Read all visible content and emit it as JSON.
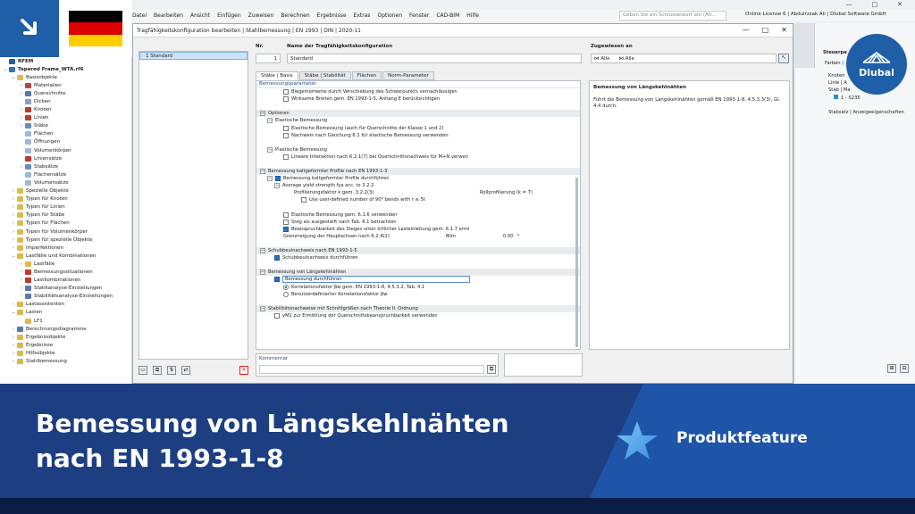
{
  "menu": [
    "Datei",
    "Bearbeiten",
    "Ansicht",
    "Einfügen",
    "Zuweisen",
    "Berechnen",
    "Ergebnisse",
    "Extras",
    "Optionen",
    "Fenster",
    "CAD-BIM",
    "Hilfe"
  ],
  "search_placeholder": "Geben Sie ein Schlüsselwort ein (Alt…",
  "license": "Online License 6 | Abdulrzzak Ali | Dlubal Software GmbH",
  "window": {
    "title": "Tragfähigkeitskonfiguration bearbeiten | Stahlbemessung | EN 1993 | DIN | 2020-11",
    "minimize": "—",
    "maximize": "□",
    "close": "✕"
  },
  "nav": {
    "items": [
      {
        "label": "RFEM",
        "arrow": "",
        "color": "#2c5aa0",
        "indent": 0
      },
      {
        "label": "Tapered Frame_WTA.rf6",
        "arrow": "⌄",
        "color": "#3b6fb5",
        "indent": 0
      },
      {
        "label": "Basisobjekte",
        "arrow": "⌄",
        "color": "#e0b84a",
        "indent": 1
      },
      {
        "label": "Materialien",
        "arrow": "›",
        "color": "#b04a3a",
        "indent": 2
      },
      {
        "label": "Querschnitte",
        "arrow": "›",
        "color": "#5a7ab0",
        "indent": 2
      },
      {
        "label": "Dicken",
        "arrow": "",
        "color": "#8aa0c0",
        "indent": 2
      },
      {
        "label": "Knoten",
        "arrow": "›",
        "color": "#c0392b",
        "indent": 2
      },
      {
        "label": "Linien",
        "arrow": "›",
        "color": "#c0392b",
        "indent": 2
      },
      {
        "label": "Stäbe",
        "arrow": "›",
        "color": "#6a8ec0",
        "indent": 2
      },
      {
        "label": "Flächen",
        "arrow": "",
        "color": "#9fb8d8",
        "indent": 2
      },
      {
        "label": "Öffnungen",
        "arrow": "",
        "color": "#9fb8d8",
        "indent": 2
      },
      {
        "label": "Volumenkörper",
        "arrow": "",
        "color": "#9fb8d8",
        "indent": 2
      },
      {
        "label": "Liniensätze",
        "arrow": "",
        "color": "#c0392b",
        "indent": 2
      },
      {
        "label": "Stabsätze",
        "arrow": "›",
        "color": "#6a8ec0",
        "indent": 2
      },
      {
        "label": "Flächensätze",
        "arrow": "",
        "color": "#9fb8d8",
        "indent": 2
      },
      {
        "label": "Volumensätze",
        "arrow": "",
        "color": "#9fb8d8",
        "indent": 2
      },
      {
        "label": "Spezielle Objekte",
        "arrow": "›",
        "color": "#e0b84a",
        "indent": 1
      },
      {
        "label": "Typen für Knoten",
        "arrow": "›",
        "color": "#e0b84a",
        "indent": 1
      },
      {
        "label": "Typen für Linien",
        "arrow": "›",
        "color": "#e0b84a",
        "indent": 1
      },
      {
        "label": "Typen für Stäbe",
        "arrow": "›",
        "color": "#e0b84a",
        "indent": 1
      },
      {
        "label": "Typen für Flächen",
        "arrow": "›",
        "color": "#e0b84a",
        "indent": 1
      },
      {
        "label": "Typen für Volumenkörper",
        "arrow": "›",
        "color": "#e0b84a",
        "indent": 1
      },
      {
        "label": "Typen für spezielle Objekte",
        "arrow": "›",
        "color": "#e0b84a",
        "indent": 1
      },
      {
        "label": "Imperfektionen",
        "arrow": "›",
        "color": "#e0b84a",
        "indent": 1
      },
      {
        "label": "Lastfälle und Kombinationen",
        "arrow": "⌄",
        "color": "#e0b84a",
        "indent": 1
      },
      {
        "label": "Lastfälle",
        "arrow": "›",
        "color": "#e0b84a",
        "indent": 2
      },
      {
        "label": "Bemessungssituationen",
        "arrow": "›",
        "color": "#c0392b",
        "indent": 2
      },
      {
        "label": "Lastkombinationen",
        "arrow": "›",
        "color": "#c0392b",
        "indent": 2
      },
      {
        "label": "Statikanalyse-Einstellungen",
        "arrow": "›",
        "color": "#5a7ab0",
        "indent": 2
      },
      {
        "label": "Stabilitätsanalyse-Einstellungen",
        "arrow": "›",
        "color": "#5a7ab0",
        "indent": 2
      },
      {
        "label": "Lastassistenten",
        "arrow": "›",
        "color": "#e0b84a",
        "indent": 1
      },
      {
        "label": "Lasten",
        "arrow": "⌄",
        "color": "#e0b84a",
        "indent": 1
      },
      {
        "label": "LF1",
        "arrow": "",
        "color": "#e0b84a",
        "indent": 2
      },
      {
        "label": "Berechnungsdiagramme",
        "arrow": "›",
        "color": "#5a7ab0",
        "indent": 1
      },
      {
        "label": "Ergebnisobjekte",
        "arrow": "›",
        "color": "#e0b84a",
        "indent": 1
      },
      {
        "label": "Ergebnisse",
        "arrow": "›",
        "color": "#e0b84a",
        "indent": 1
      },
      {
        "label": "Hilfsobjekte",
        "arrow": "›",
        "color": "#e0b84a",
        "indent": 1
      },
      {
        "label": "Stahlbemessung",
        "arrow": "›",
        "color": "#e0b84a",
        "indent": 1
      }
    ]
  },
  "list": {
    "selected": "1   Standard"
  },
  "fields": {
    "nr_label": "Nr.",
    "nr_value": "1",
    "name_label": "Name der Tragfähigkeitskonfiguration",
    "name_value": "Standard",
    "assigned_label": "Zugewiesen an",
    "assigned_1": "Alle",
    "assigned_2": "Alle"
  },
  "tabs": [
    "Stäbe | Basis",
    "Stäbe | Stabilität",
    "Flächen",
    "Norm-Parameter"
  ],
  "panel": {
    "header": "Bemessungsparameter",
    "rows": [
      {
        "type": "cb",
        "on": false,
        "indent": 30,
        "text": "Biegemomente durch Verschiebung des Schwerpunkts vernachlässigen"
      },
      {
        "type": "cb",
        "on": false,
        "indent": 30,
        "text": "Wirksame Breiten gem. EN 1993-1-5, Anhang E berücksichtigen"
      },
      {
        "type": "blank",
        "text": ""
      },
      {
        "type": "sec",
        "indent": 4,
        "text": "Optionen"
      },
      {
        "type": "grp",
        "indent": 12,
        "text": "Elastische Bemessung"
      },
      {
        "type": "cb",
        "on": false,
        "indent": 30,
        "text": "Elastische Bemessung (auch für Querschnitte der Klasse 1 und 2)"
      },
      {
        "type": "cb",
        "on": false,
        "indent": 30,
        "text": "Nachweis nach Gleichung 6.1 für elastische Bemessung verwenden"
      },
      {
        "type": "blank",
        "text": ""
      },
      {
        "type": "grp",
        "indent": 12,
        "text": "Plastische Bemessung"
      },
      {
        "type": "cb",
        "on": false,
        "indent": 30,
        "text": "Lineare Interaktion nach 6.2.1(7) bei Querschnittsnachweis für M+N verwen"
      },
      {
        "type": "blank",
        "text": ""
      },
      {
        "type": "sec",
        "indent": 4,
        "text": "Bemessung kaltgeformter Profile nach EN 1993-1-3"
      },
      {
        "type": "cbgrp",
        "on": true,
        "indent": 12,
        "text": "Bemessung kaltgeformter Profile durchführen"
      },
      {
        "type": "grp",
        "indent": 20,
        "text": "Average yield strength fya acc. to 3.2.2"
      },
      {
        "type": "plain",
        "indent": 42,
        "text": "Profilierungsfaktor k gem. 3.2.2(3)",
        "val": "Rollprofilierung (k = 7)"
      },
      {
        "type": "cb",
        "on": false,
        "indent": 50,
        "text": "Use user-defined number of 90° bends with r ≤ 5t"
      },
      {
        "type": "blank",
        "text": ""
      },
      {
        "type": "cb",
        "on": false,
        "indent": 30,
        "text": "Elastische Bemessung gem. 6.1.6 verwenden"
      },
      {
        "type": "cb",
        "on": false,
        "indent": 30,
        "text": "Steg als ausgesteift nach Tab. 6.1 betrachten"
      },
      {
        "type": "cb",
        "on": true,
        "indent": 30,
        "text": "Beanspruchbarkeit des Steges unter örtlicher Lasteinleitung gem. 6.1.7 ermi"
      },
      {
        "type": "plain",
        "indent": 30,
        "text": "Grenzneigung der Hauptachsen nach 6.2.4(2)",
        "sym": "θlim",
        "num": "0.00",
        "unit": "°"
      },
      {
        "type": "blank",
        "text": ""
      },
      {
        "type": "sec",
        "indent": 4,
        "text": "Schubbeulnachweis nach EN 1993-1-5"
      },
      {
        "type": "cb",
        "on": true,
        "indent": 20,
        "text": "Schubbeulnachweis durchführen"
      },
      {
        "type": "blank",
        "text": ""
      },
      {
        "type": "sec",
        "indent": 4,
        "text": "Bemessung von Längskehlnähten"
      },
      {
        "type": "cbsel",
        "on": true,
        "indent": 20,
        "text": "Bemessung durchführen"
      },
      {
        "type": "rad",
        "on": true,
        "indent": 30,
        "text": "Korrelationsfaktor βw gem. EN 1993-1-8, 4.5.3.2, Tab. 4.1"
      },
      {
        "type": "rad",
        "on": false,
        "indent": 30,
        "text": "Benutzerdefinierter Korrelationsfaktor βw"
      },
      {
        "type": "blank",
        "text": ""
      },
      {
        "type": "sec",
        "indent": 4,
        "text": "Stabilitätsnachweise mit Schnittgrößen nach Theorie II. Ordnung"
      },
      {
        "type": "cb",
        "on": false,
        "indent": 20,
        "text": "γM1 zur Ermittlung der Querschnittsbeanspruchbarkeit verwenden"
      }
    ]
  },
  "desc": {
    "title": "Bemessung von Längskehlnähten",
    "body": "Führt die Bemessung von Längskehlnähten gemäß EN 1993-1-8, 4.5.3.3(3), Gl. 4.4 durch."
  },
  "comment_label": "Kommentar",
  "right": {
    "label1": "Steuerpa",
    "label2": "Farben (",
    "label3": "Knoten",
    "label4": "Linie | A",
    "label5": "Stab | Ma",
    "label6": "1 - S235",
    "label7": "Stabsatz | Anzeigeeigenschaften"
  },
  "logo": "Dlubal",
  "banner": {
    "title_line1": "Bemessung von Längskehlnähten",
    "title_line2": "nach EN 1993-1-8",
    "feature": "Produktfeature"
  },
  "colors": {
    "banner": "#1d3f82",
    "accent": "#1f55a8",
    "flag_black": "#000000",
    "flag_red": "#dd0000",
    "flag_gold": "#ffce00"
  }
}
